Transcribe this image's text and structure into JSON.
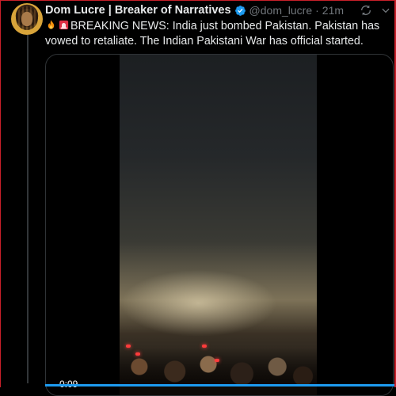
{
  "tweet": {
    "author_name": "Dom Lucre | Breaker of Narratives",
    "handle": "@dom_lucre",
    "separator": "·",
    "time_ago": "21m",
    "verified": true,
    "emoji_1": "fire",
    "emoji_2": "rotating-light",
    "text": "BREAKING NEWS: India just bombed Pakistan. Pakistan has vowed to retaliate. The Indian Pakistani War has official started."
  },
  "media": {
    "type": "video",
    "timestamp": "0:09",
    "progress_fraction": 1.0
  },
  "icons": {
    "more": "grok-refresh-icon",
    "menu": "chevron-down-icon"
  },
  "colors": {
    "accent": "#1d9bf0",
    "frame": "#c8202a",
    "handle": "#71767b",
    "text": "#e7e9ea"
  }
}
